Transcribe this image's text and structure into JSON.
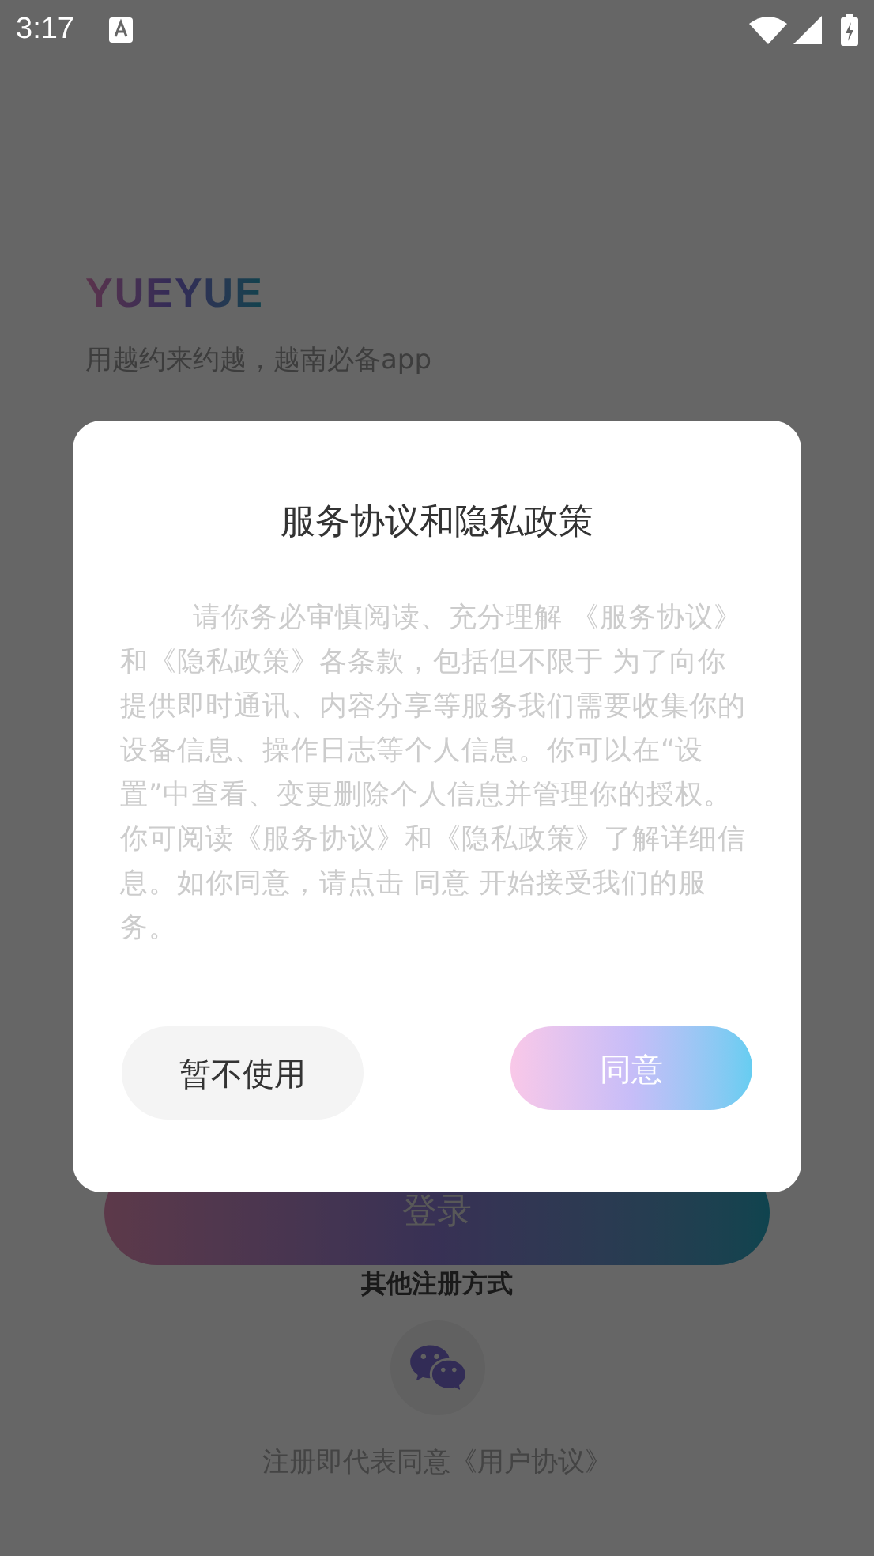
{
  "status_bar": {
    "time": "3:17"
  },
  "app": {
    "logo": "YUEYUE",
    "tagline": "用越约来约越，越南必备app",
    "login_button": "登录",
    "other_methods": "其他注册方式",
    "agreement": "注册即代表同意《用户协议》"
  },
  "dialog": {
    "title": "服务协议和隐私政策",
    "body": "请你务必审慎阅读、充分理解 《服务协议》和《隐私政策》各条款，包括但不限于 为了向你提供即时通讯、内容分享等服务我们需要收集你的设备信息、操作日志等个人信息。你可以在“设置”中查看、变更删除个人信息并管理你的授权。你可阅读《服务协议》和《隐私政策》了解详细信息。如你同意，请点击 同意 开始接受我们的服务。",
    "buttons": [
      {
        "label": "暂不使用",
        "kind": "secondary"
      },
      {
        "label": "同意",
        "kind": "primary"
      }
    ]
  }
}
